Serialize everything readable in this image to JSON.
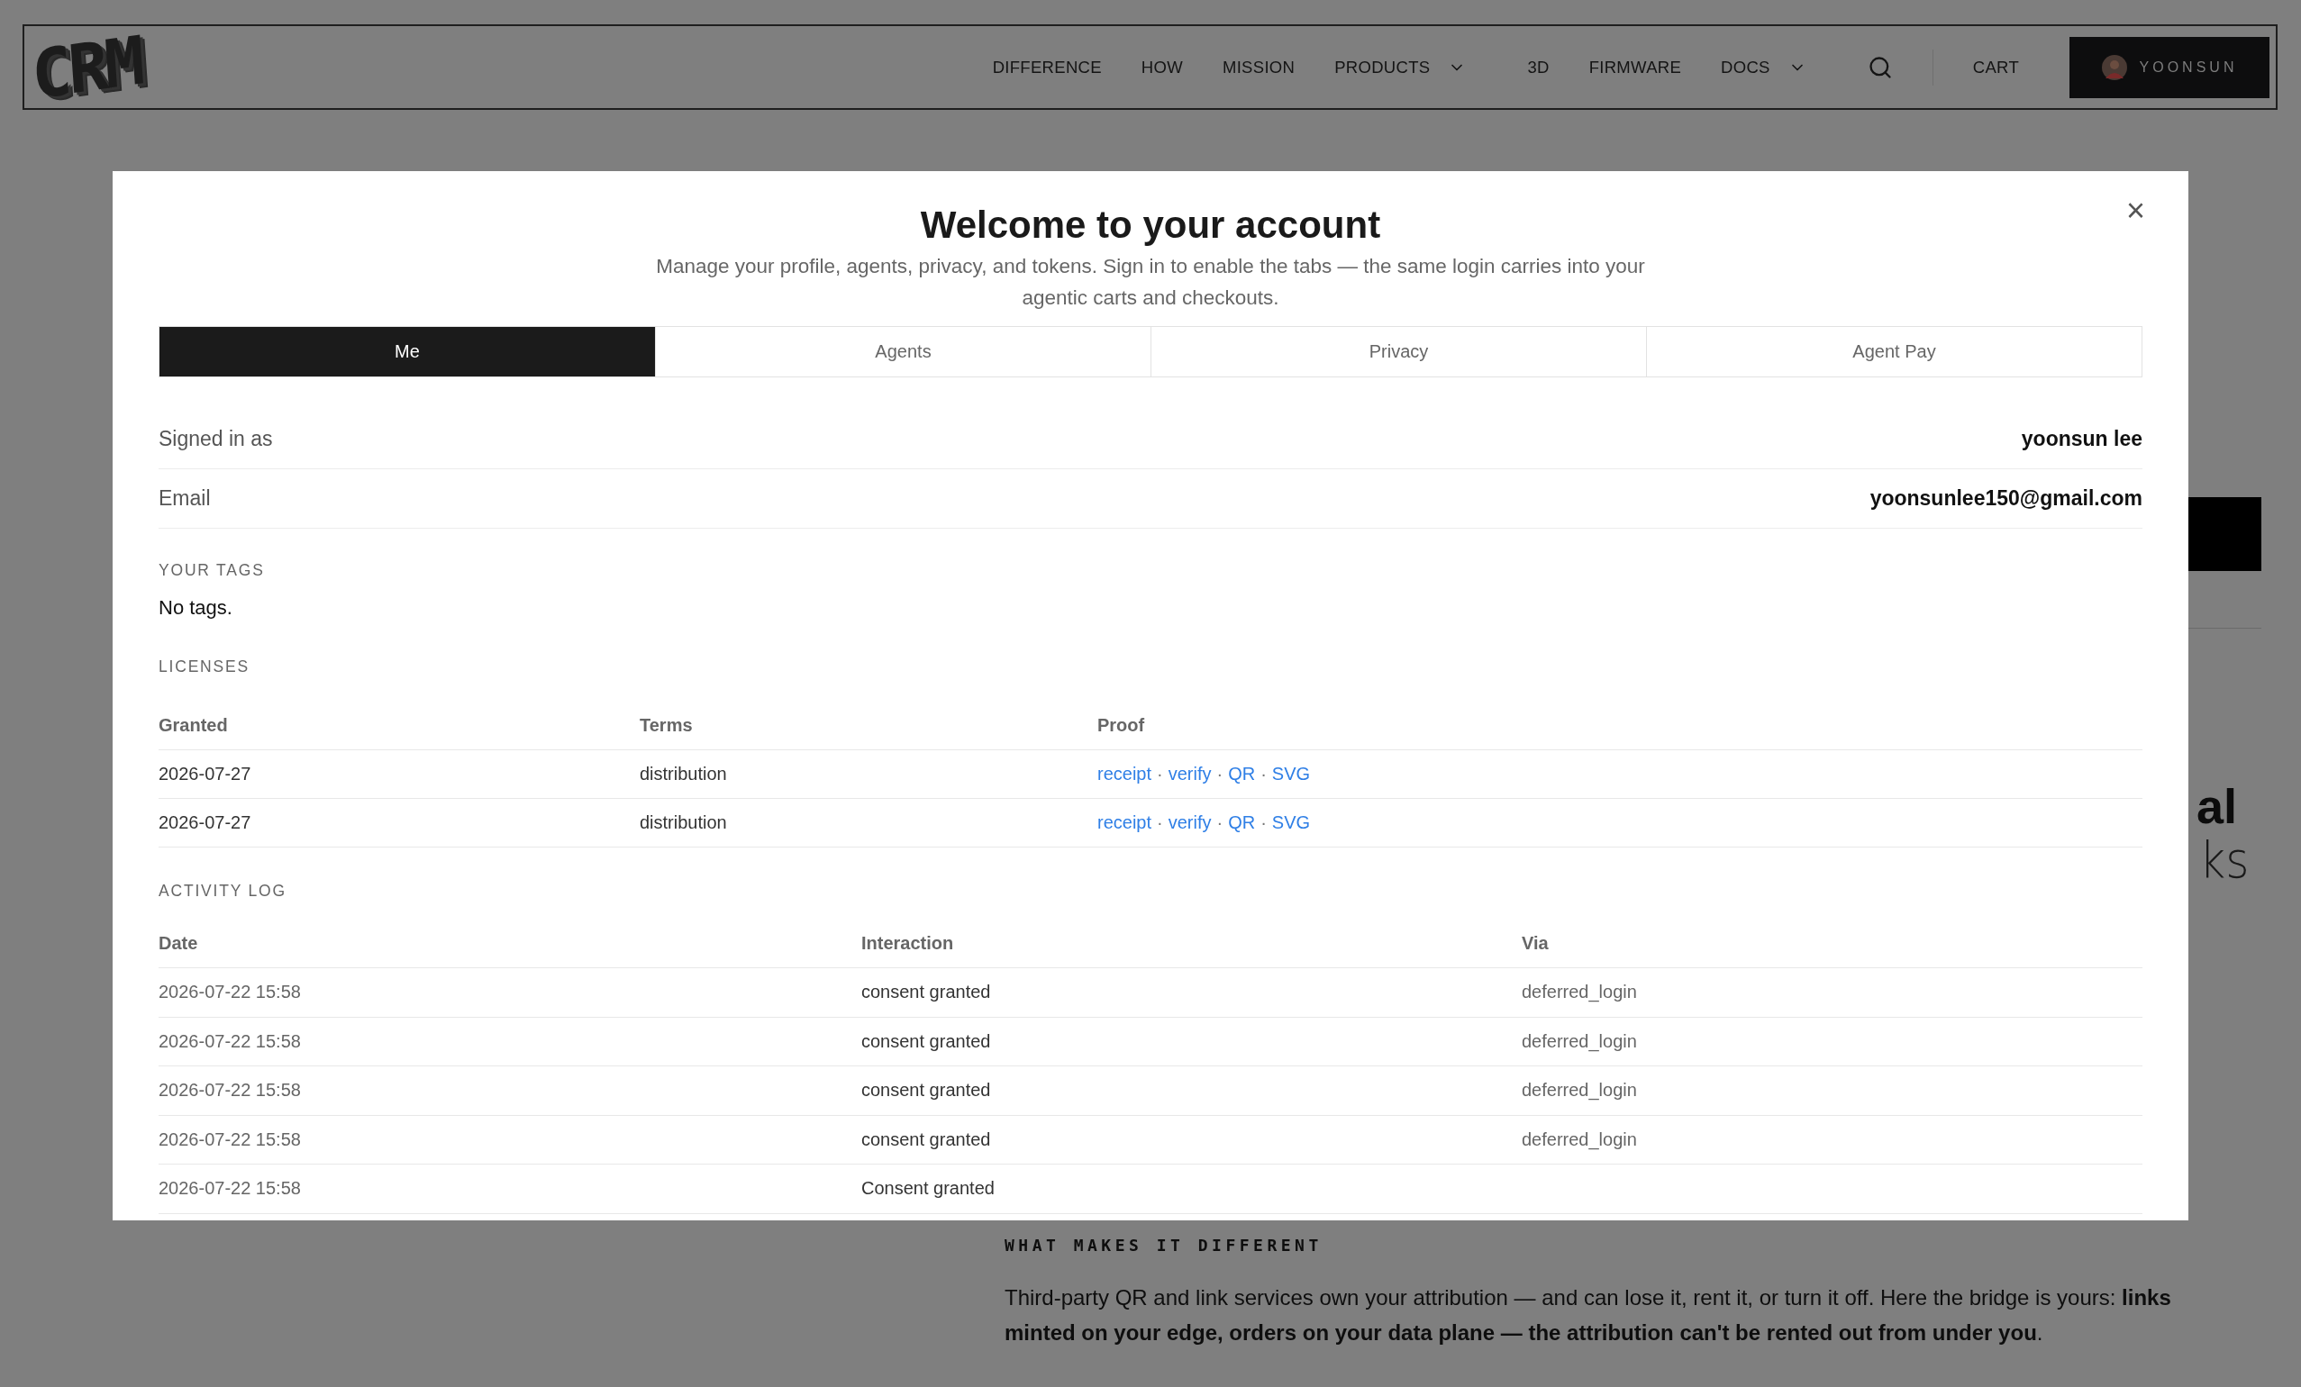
{
  "header": {
    "logo": "CRM",
    "nav": [
      {
        "label": "DIFFERENCE",
        "dropdown": false
      },
      {
        "label": "HOW",
        "dropdown": false
      },
      {
        "label": "MISSION",
        "dropdown": false
      },
      {
        "label": "PRODUCTS",
        "dropdown": true
      },
      {
        "label": "3D",
        "dropdown": false
      },
      {
        "label": "FIRMWARE",
        "dropdown": false
      },
      {
        "label": "DOCS",
        "dropdown": true
      }
    ],
    "cart": "CART",
    "user": "YOONSUN"
  },
  "background": {
    "heading_fragments": [
      "al",
      "ks"
    ],
    "section_label": "WHAT MAKES IT DIFFERENT",
    "paragraph": "Third-party QR and link services own your attribution — and can lose it, rent it, or turn it off. Here the bridge is yours: **links minted on your edge, orders on your data plane — the attribution can't be rented out from under you**."
  },
  "modal": {
    "title": "Welcome to your account",
    "subtitle": "Manage your profile, agents, privacy, and tokens. Sign in to enable the tabs — the same login carries into your agentic carts and checkouts.",
    "close": "×",
    "tabs": [
      {
        "label": "Me",
        "selected": true
      },
      {
        "label": "Agents",
        "selected": false
      },
      {
        "label": "Privacy",
        "selected": false
      },
      {
        "label": "Agent Pay",
        "selected": false
      }
    ],
    "fields": [
      {
        "label": "Signed in as",
        "value": "yoonsun lee"
      },
      {
        "label": "Email",
        "value": "yoonsunlee150@gmail.com"
      }
    ],
    "tags": {
      "heading": "YOUR TAGS",
      "empty": "No tags."
    },
    "licenses": {
      "heading": "LICENSES",
      "columns": [
        "Granted",
        "Terms",
        "Proof"
      ],
      "separator": "·",
      "rows": [
        {
          "granted": "2026-07-27",
          "terms": "distribution",
          "proof": [
            "receipt",
            "verify",
            "QR",
            "SVG"
          ]
        },
        {
          "granted": "2026-07-27",
          "terms": "distribution",
          "proof": [
            "receipt",
            "verify",
            "QR",
            "SVG"
          ]
        }
      ]
    },
    "activity": {
      "heading": "ACTIVITY LOG",
      "columns": [
        "Date",
        "Interaction",
        "Via"
      ],
      "rows": [
        {
          "date": "2026-07-22 15:58",
          "interaction": "consent granted",
          "via": "deferred_login"
        },
        {
          "date": "2026-07-22 15:58",
          "interaction": "consent granted",
          "via": "deferred_login"
        },
        {
          "date": "2026-07-22 15:58",
          "interaction": "consent granted",
          "via": "deferred_login"
        },
        {
          "date": "2026-07-22 15:58",
          "interaction": "consent granted",
          "via": "deferred_login"
        },
        {
          "date": "2026-07-22 15:58",
          "interaction": "Consent granted"
        }
      ]
    }
  }
}
